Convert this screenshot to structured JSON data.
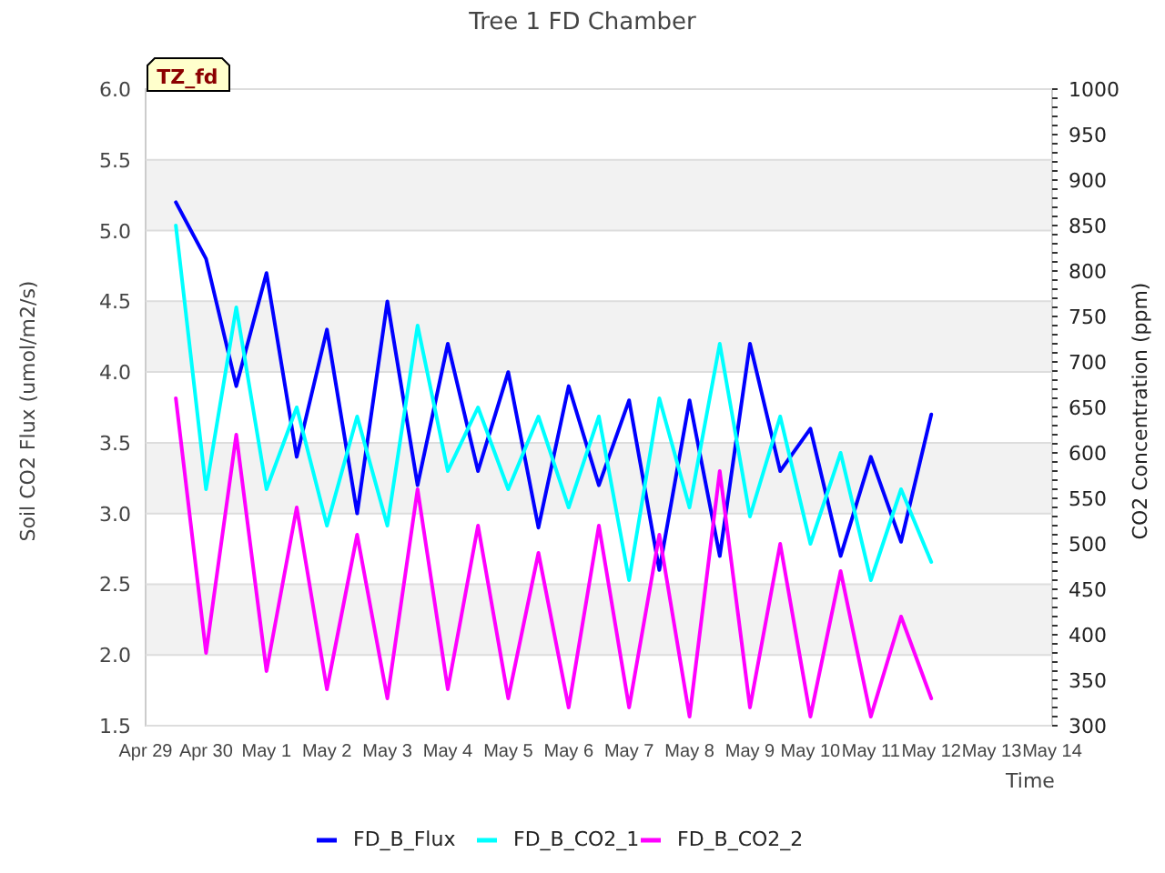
{
  "title": "Tree 1 FD Chamber",
  "tag": "TZ_fd",
  "chart_data": {
    "type": "line",
    "xlabel": "Time",
    "ylabel": "Soil CO2 Flux (umol/m2/s)",
    "y2label": "CO2 Concentration (ppm)",
    "categories": [
      "Apr 29",
      null,
      "Apr 30",
      null,
      "May 1",
      null,
      "May 2",
      null,
      "May 3",
      null,
      "May 4",
      null,
      "May 5",
      null,
      "May 6",
      null,
      "May 7",
      null,
      "May 8",
      null,
      "May 9",
      null,
      "May 10",
      null,
      "May 11",
      null,
      "May 12",
      null,
      "May 13",
      null,
      "May 14"
    ],
    "grid": true,
    "legend": "bottom",
    "ylim": [
      1.5,
      6.0
    ],
    "y2lim": [
      300,
      1000
    ],
    "yticks": [
      {
        "value": 1.5,
        "label": "1.5"
      },
      {
        "value": 2.0,
        "label": "2.0"
      },
      {
        "value": 2.5,
        "label": "2.5"
      },
      {
        "value": 3.0,
        "label": "3.0"
      },
      {
        "value": 3.5,
        "label": "3.5"
      },
      {
        "value": 4.0,
        "label": "4.0"
      },
      {
        "value": 4.5,
        "label": "4.5"
      },
      {
        "value": 5.0,
        "label": "5.0"
      },
      {
        "value": 5.5,
        "label": "5.5"
      },
      {
        "value": 6.0,
        "label": "6.0"
      }
    ],
    "y2ticks": [
      300,
      350,
      400,
      450,
      500,
      550,
      600,
      650,
      700,
      750,
      800,
      850,
      900,
      950,
      1000
    ],
    "series": [
      {
        "name": "FD_B_Flux",
        "color": "#0000ff",
        "axis": "y",
        "values": [
          null,
          5.2,
          4.8,
          3.9,
          4.7,
          3.4,
          4.3,
          3.0,
          4.5,
          3.2,
          4.2,
          3.3,
          4.0,
          2.9,
          3.9,
          3.2,
          3.8,
          2.6,
          3.8,
          2.7,
          4.2,
          3.3,
          3.6,
          2.7,
          3.4,
          2.8,
          3.7,
          null,
          null,
          null,
          null
        ]
      },
      {
        "name": "FD_B_CO2_1",
        "color": "#00ffff",
        "axis": "y2",
        "values": [
          null,
          850,
          560,
          760,
          560,
          650,
          520,
          640,
          520,
          740,
          580,
          650,
          560,
          640,
          540,
          640,
          460,
          660,
          540,
          720,
          530,
          640,
          500,
          600,
          460,
          560,
          480,
          null,
          null,
          null,
          null
        ]
      },
      {
        "name": "FD_B_CO2_2",
        "color": "#ff00ff",
        "axis": "y2",
        "values": [
          null,
          660,
          380,
          620,
          360,
          540,
          340,
          510,
          330,
          560,
          340,
          520,
          330,
          490,
          320,
          520,
          320,
          510,
          310,
          580,
          320,
          500,
          310,
          470,
          310,
          420,
          330,
          null,
          null,
          null,
          null
        ]
      }
    ]
  }
}
